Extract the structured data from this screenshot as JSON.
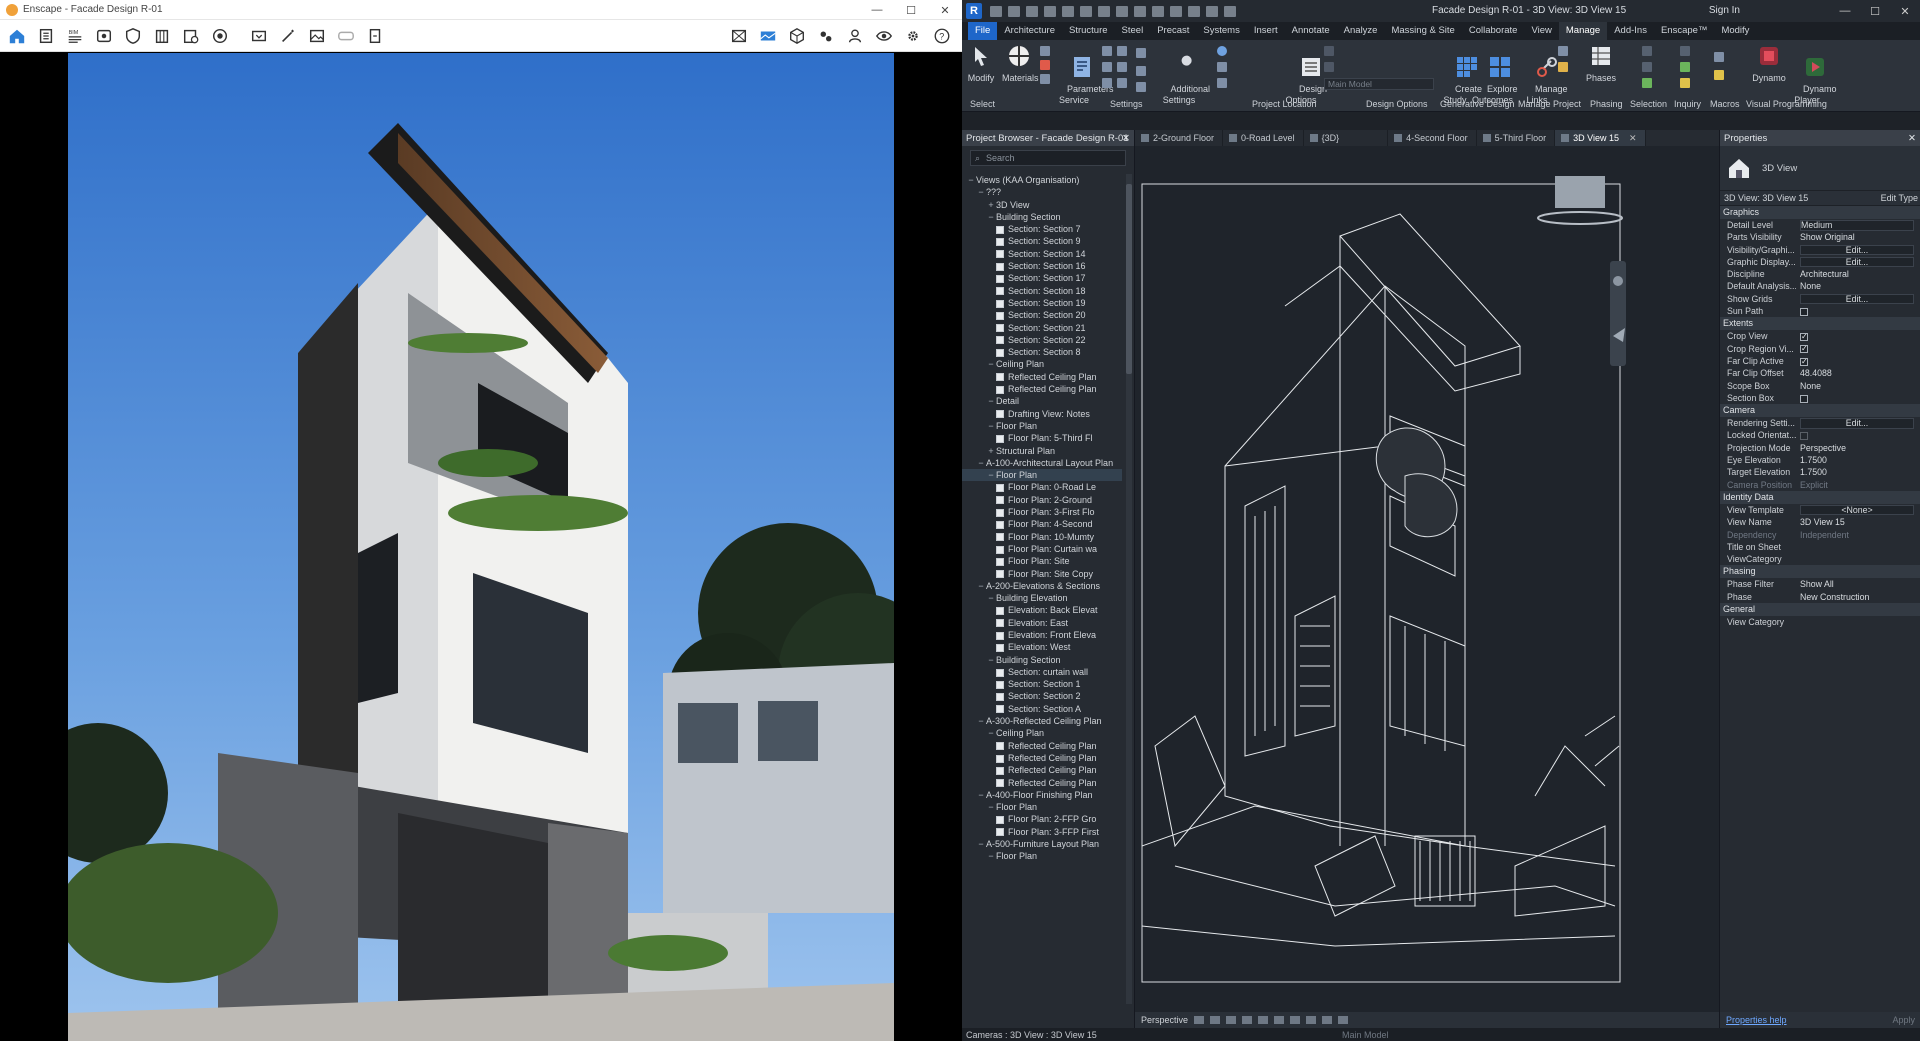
{
  "enscape": {
    "window_title": "Enscape - Facade Design R-01",
    "toolbar_left": [
      "home-icon",
      "document-icon",
      "bim-list-icon",
      "view-icon",
      "shield-icon",
      "building-icon",
      "asset-library-icon",
      "material-icon",
      "screenshot-icon",
      "magic-wand-icon",
      "image-icon",
      "vr-headset-icon",
      "export-icon"
    ],
    "toolbar_right": [
      "capture-icon",
      "panorama-icon",
      "cube-icon",
      "walk-icon",
      "camera-person-icon",
      "visibility-icon",
      "settings-icon",
      "help-icon"
    ]
  },
  "revit": {
    "document_title": "Facade Design R-01 - 3D View: 3D View 15",
    "sign_in": "Sign In",
    "tabs": [
      "File",
      "Architecture",
      "Structure",
      "Steel",
      "Precast",
      "Systems",
      "Insert",
      "Annotate",
      "Analyze",
      "Massing & Site",
      "Collaborate",
      "View",
      "Manage",
      "Add-Ins",
      "Enscape™",
      "Modify"
    ],
    "active_tab": "Manage",
    "ribbon": {
      "modify": "Modify",
      "materials": "Materials",
      "parameters_service": "Parameters\nService",
      "additional_settings": "Additional\nSettings",
      "design_options": "Design\nOptions",
      "main_model": "Main Model",
      "create_study": "Create\nStudy",
      "explore_outcomes": "Explore\nOutcomes",
      "manage_links": "Manage\nLinks",
      "phases": "Phases",
      "dynamo": "Dynamo",
      "dynamo_player": "Dynamo\nPlayer",
      "groups": [
        "Select",
        "Settings",
        "Project Location",
        "Design Options",
        "Generative Design",
        "Manage Project",
        "Phasing",
        "Selection",
        "Inquiry",
        "Macros",
        "Visual Programming"
      ]
    },
    "project_browser": {
      "title": "Project Browser - Facade Design R-01",
      "search_placeholder": "Search",
      "tree": [
        {
          "label": "Views (KAA Organisation)",
          "depth": 0,
          "exp": "−",
          "type": "root"
        },
        {
          "label": "???",
          "depth": 1,
          "exp": "−"
        },
        {
          "label": "3D View",
          "depth": 2,
          "exp": "+"
        },
        {
          "label": "Building Section",
          "depth": 2,
          "exp": "−"
        },
        {
          "label": "Section: Section 7",
          "depth": 3,
          "leaf": true
        },
        {
          "label": "Section: Section 9",
          "depth": 3,
          "leaf": true
        },
        {
          "label": "Section: Section 14",
          "depth": 3,
          "leaf": true
        },
        {
          "label": "Section: Section 16",
          "depth": 3,
          "leaf": true
        },
        {
          "label": "Section: Section 17",
          "depth": 3,
          "leaf": true
        },
        {
          "label": "Section: Section 18",
          "depth": 3,
          "leaf": true
        },
        {
          "label": "Section: Section 19",
          "depth": 3,
          "leaf": true
        },
        {
          "label": "Section: Section 20",
          "depth": 3,
          "leaf": true
        },
        {
          "label": "Section: Section 21",
          "depth": 3,
          "leaf": true
        },
        {
          "label": "Section: Section 22",
          "depth": 3,
          "leaf": true
        },
        {
          "label": "Section: Section 8",
          "depth": 3,
          "leaf": true
        },
        {
          "label": "Ceiling Plan",
          "depth": 2,
          "exp": "−"
        },
        {
          "label": "Reflected Ceiling Plan",
          "depth": 3,
          "leaf": true
        },
        {
          "label": "Reflected Ceiling Plan",
          "depth": 3,
          "leaf": true
        },
        {
          "label": "Detail",
          "depth": 2,
          "exp": "−"
        },
        {
          "label": "Drafting View: Notes",
          "depth": 3,
          "leaf": true
        },
        {
          "label": "Floor Plan",
          "depth": 2,
          "exp": "−"
        },
        {
          "label": "Floor Plan: 5-Third Fl",
          "depth": 3,
          "leaf": true
        },
        {
          "label": "Structural Plan",
          "depth": 2,
          "exp": "+"
        },
        {
          "label": "A-100-Architectural Layout Plan",
          "depth": 1,
          "exp": "−"
        },
        {
          "label": "Floor Plan",
          "depth": 2,
          "exp": "−",
          "sel": true
        },
        {
          "label": "Floor Plan: 0-Road Le",
          "depth": 3,
          "leaf": true
        },
        {
          "label": "Floor Plan: 2-Ground",
          "depth": 3,
          "leaf": true
        },
        {
          "label": "Floor Plan: 3-First Flo",
          "depth": 3,
          "leaf": true
        },
        {
          "label": "Floor Plan: 4-Second",
          "depth": 3,
          "leaf": true
        },
        {
          "label": "Floor Plan: 10-Mumty",
          "depth": 3,
          "leaf": true
        },
        {
          "label": "Floor Plan: Curtain wa",
          "depth": 3,
          "leaf": true
        },
        {
          "label": "Floor Plan: Site",
          "depth": 3,
          "leaf": true
        },
        {
          "label": "Floor Plan: Site Copy",
          "depth": 3,
          "leaf": true
        },
        {
          "label": "A-200-Elevations & Sections",
          "depth": 1,
          "exp": "−"
        },
        {
          "label": "Building Elevation",
          "depth": 2,
          "exp": "−"
        },
        {
          "label": "Elevation: Back Elevat",
          "depth": 3,
          "leaf": true
        },
        {
          "label": "Elevation: East",
          "depth": 3,
          "leaf": true
        },
        {
          "label": "Elevation: Front Eleva",
          "depth": 3,
          "leaf": true
        },
        {
          "label": "Elevation: West",
          "depth": 3,
          "leaf": true
        },
        {
          "label": "Building Section",
          "depth": 2,
          "exp": "−"
        },
        {
          "label": "Section: curtain wall",
          "depth": 3,
          "leaf": true
        },
        {
          "label": "Section: Section 1",
          "depth": 3,
          "leaf": true
        },
        {
          "label": "Section: Section 2",
          "depth": 3,
          "leaf": true
        },
        {
          "label": "Section: Section A",
          "depth": 3,
          "leaf": true
        },
        {
          "label": "A-300-Reflected Ceiling Plan",
          "depth": 1,
          "exp": "−"
        },
        {
          "label": "Ceiling Plan",
          "depth": 2,
          "exp": "−"
        },
        {
          "label": "Reflected Ceiling Plan",
          "depth": 3,
          "leaf": true
        },
        {
          "label": "Reflected Ceiling Plan",
          "depth": 3,
          "leaf": true
        },
        {
          "label": "Reflected Ceiling Plan",
          "depth": 3,
          "leaf": true
        },
        {
          "label": "Reflected Ceiling Plan",
          "depth": 3,
          "leaf": true
        },
        {
          "label": "A-400-Floor Finishing Plan",
          "depth": 1,
          "exp": "−"
        },
        {
          "label": "Floor Plan",
          "depth": 2,
          "exp": "−"
        },
        {
          "label": "Floor Plan: 2-FFP Gro",
          "depth": 3,
          "leaf": true
        },
        {
          "label": "Floor Plan: 3-FFP First",
          "depth": 3,
          "leaf": true
        },
        {
          "label": "A-500-Furniture Layout Plan",
          "depth": 1,
          "exp": "−"
        },
        {
          "label": "Floor Plan",
          "depth": 2,
          "exp": "−"
        }
      ]
    },
    "view_tabs": [
      "2-Ground Floor",
      "0-Road Level",
      "{3D}",
      "4-Second Floor",
      "5-Third Floor",
      "3D View 15"
    ],
    "active_view_tab": "3D View 15",
    "view_status": "Perspective",
    "properties": {
      "title": "Properties",
      "type_name": "3D View",
      "selector": "3D View: 3D View 15",
      "edit_type": "Edit Type",
      "groups": [
        {
          "name": "Graphics",
          "rows": [
            {
              "k": "Detail Level",
              "v": "Medium",
              "style": "box"
            },
            {
              "k": "Parts Visibility",
              "v": "Show Original"
            },
            {
              "k": "Visibility/Graphi...",
              "v": "Edit...",
              "style": "btn"
            },
            {
              "k": "Graphic Display...",
              "v": "Edit...",
              "style": "btn"
            },
            {
              "k": "Discipline",
              "v": "Architectural"
            },
            {
              "k": "Default Analysis...",
              "v": "None"
            },
            {
              "k": "Show Grids",
              "v": "Edit...",
              "style": "btn"
            },
            {
              "k": "Sun Path",
              "v": "",
              "style": "cb"
            }
          ]
        },
        {
          "name": "Extents",
          "rows": [
            {
              "k": "Crop View",
              "v": "",
              "style": "cbon"
            },
            {
              "k": "Crop Region Vi...",
              "v": "",
              "style": "cbon"
            },
            {
              "k": "Far Clip Active",
              "v": "",
              "style": "cbon"
            },
            {
              "k": "Far Clip Offset",
              "v": "48.4088"
            },
            {
              "k": "Scope Box",
              "v": "None"
            },
            {
              "k": "Section Box",
              "v": "",
              "style": "cb"
            }
          ]
        },
        {
          "name": "Camera",
          "rows": [
            {
              "k": "Rendering Setti...",
              "v": "Edit...",
              "style": "btn"
            },
            {
              "k": "Locked Orientat...",
              "v": "",
              "style": "cbdim"
            },
            {
              "k": "Projection Mode",
              "v": "Perspective"
            },
            {
              "k": "Eye Elevation",
              "v": "1.7500"
            },
            {
              "k": "Target Elevation",
              "v": "1.7500"
            },
            {
              "k": "Camera Position",
              "v": "Explicit",
              "style": "dim"
            }
          ]
        },
        {
          "name": "Identity Data",
          "rows": [
            {
              "k": "View Template",
              "v": "<None>",
              "style": "btn"
            },
            {
              "k": "View Name",
              "v": "3D View 15"
            },
            {
              "k": "Dependency",
              "v": "Independent",
              "style": "dim"
            },
            {
              "k": "Title on Sheet",
              "v": ""
            },
            {
              "k": "ViewCategory",
              "v": ""
            }
          ]
        },
        {
          "name": "Phasing",
          "rows": [
            {
              "k": "Phase Filter",
              "v": "Show All"
            },
            {
              "k": "Phase",
              "v": "New Construction"
            }
          ]
        },
        {
          "name": "General",
          "rows": [
            {
              "k": "View Category",
              "v": ""
            }
          ]
        }
      ],
      "help": "Properties help",
      "apply": "Apply"
    },
    "status_bar": "Cameras : 3D View : 3D View 15",
    "status_right": "Main Model"
  },
  "colors": {
    "revit_blue": "#1e66c9",
    "sky": "#3f7ed2",
    "dark_bg": "#1f242b"
  }
}
